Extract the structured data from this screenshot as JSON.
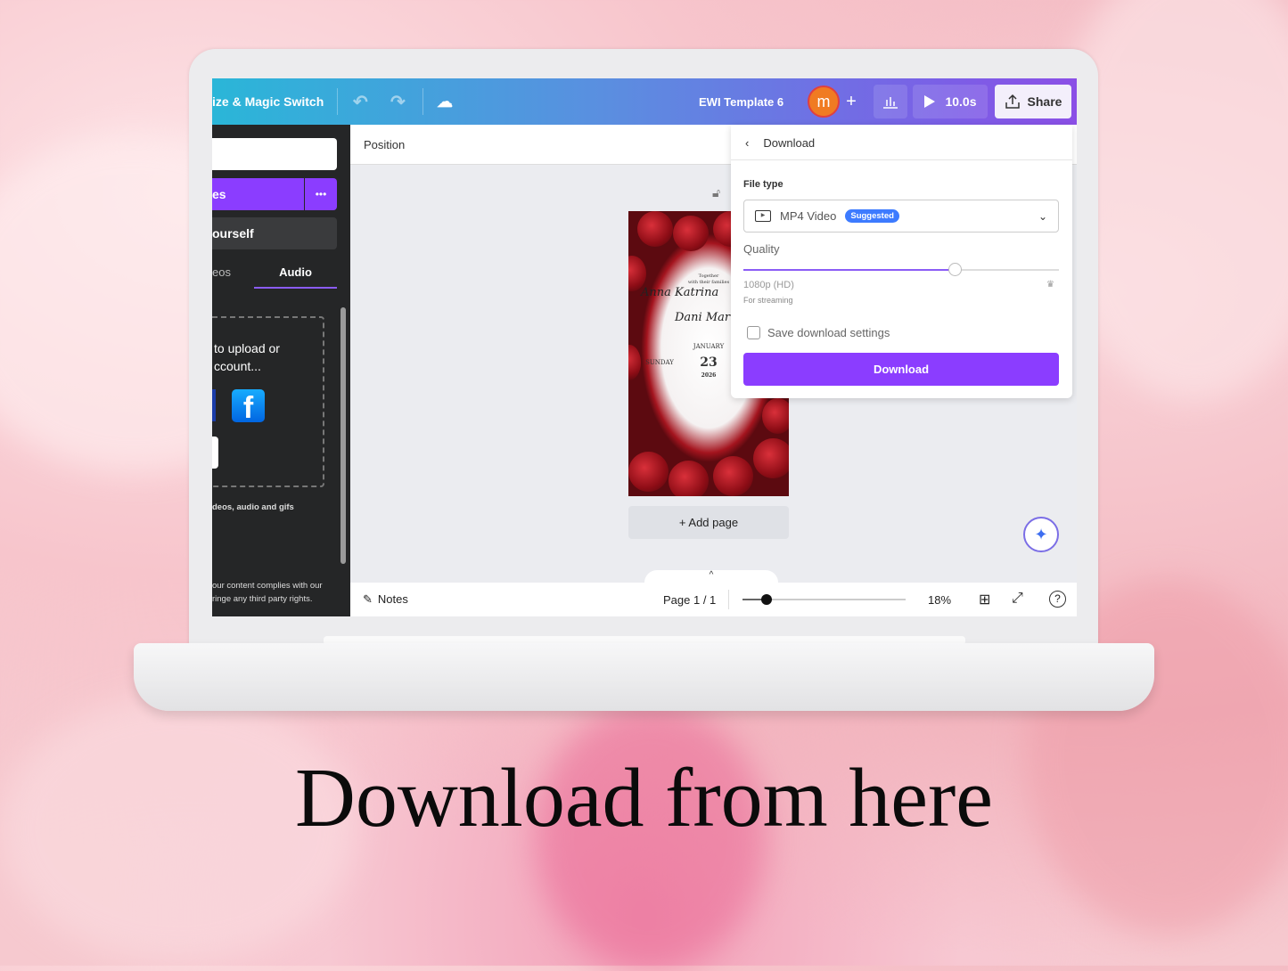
{
  "topbar": {
    "resize_label": "ize & Magic Switch",
    "doc_title": "EWI Template 6",
    "avatar_letter": "m",
    "duration": "10.0s",
    "share_label": "Share"
  },
  "sidebar": {
    "primary_button": "es",
    "more_label": "•••",
    "secondary_button": "ourself",
    "tabs": [
      {
        "label": "eos"
      },
      {
        "label": "Audio"
      }
    ],
    "upload_text_1": "to upload or",
    "upload_text_2": "ccount...",
    "formats_text": "deos, audio and gifs",
    "terms_1": "our content complies with our",
    "terms_2": "ringe any third party rights."
  },
  "canvas": {
    "position_label": "Position",
    "add_page_label": "+ Add page"
  },
  "invitation": {
    "line1": "Together",
    "line2": "with their families",
    "bride": "Anna Katrina",
    "and": "and",
    "groom": "Dani Mar",
    "month": "JANUARY",
    "weekday": "SUNDAY",
    "day": "23",
    "year": "2026"
  },
  "download_panel": {
    "title": "Download",
    "file_type_label": "File type",
    "file_type_value": "MP4 Video",
    "suggested_badge": "Suggested",
    "quality_label": "Quality",
    "quality_value": "1080p (HD)",
    "quality_fraction": 0.67,
    "quality_note": "For streaming",
    "save_settings_label": "Save download settings",
    "save_settings_checked": false,
    "download_button": "Download"
  },
  "bottombar": {
    "notes_label": "Notes",
    "page_indicator": "Page 1 / 1",
    "zoom_value": "18%",
    "zoom_fraction": 0.15
  },
  "headline": "Download from here",
  "colors": {
    "accent": "#8b3dff",
    "badge": "#3d7bff",
    "avatar": "#f07b22"
  }
}
